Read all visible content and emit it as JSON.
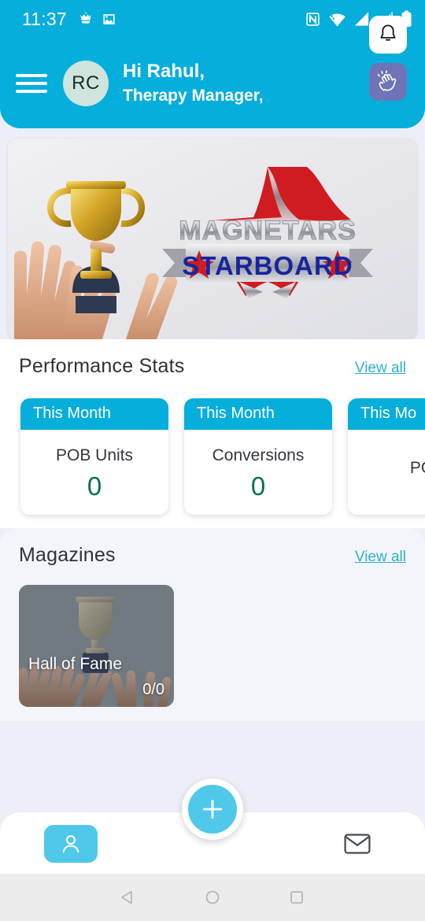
{
  "status_bar": {
    "time": "11:37",
    "left_icons": [
      "crown-notification-icon",
      "image-notification-icon"
    ],
    "right_icons": [
      "nfc-icon",
      "wifi-icon",
      "signal-sim1-icon",
      "signal-sim2-icon",
      "battery-icon"
    ]
  },
  "header": {
    "menu_icon": "hamburger-menu-icon",
    "avatar_initials": "RC",
    "greeting_line1": "Hi Rahul,",
    "greeting_line2": "Therapy Manager,",
    "bell_icon": "notification-bell-icon",
    "clap_icon": "clapping-hands-icon",
    "background_color": "#06aedb"
  },
  "banner": {
    "brand_text": "MAGNETARS",
    "ribbon_text": "STARBOARD",
    "alt": "trophy held by raised hands with Magnetars Starboard logo"
  },
  "performance": {
    "title": "Performance Stats",
    "view_all_label": "View all",
    "cards": [
      {
        "period": "This Month",
        "label": "POB Units",
        "value": "0"
      },
      {
        "period": "This Month",
        "label": "Conversions",
        "value": "0"
      },
      {
        "period": "This Mo",
        "label": "PO",
        "value": ""
      }
    ]
  },
  "magazines": {
    "title": "Magazines",
    "view_all_label": "View all",
    "items": [
      {
        "title": "Hall of Fame",
        "count": "0/0"
      }
    ]
  },
  "bottom_nav": {
    "items": [
      {
        "name": "profile",
        "icon": "person-icon",
        "active": true
      },
      {
        "name": "add",
        "icon": "plus-icon",
        "active": false
      },
      {
        "name": "mail",
        "icon": "envelope-icon",
        "active": false
      }
    ],
    "accent_color": "#4fc8ea"
  },
  "system_nav": {
    "back": "back-triangle-icon",
    "home": "home-circle-icon",
    "recents": "recents-square-icon"
  },
  "colors": {
    "primary": "#06aedb",
    "accent": "#4fc8ea",
    "link": "#2bb3c8",
    "value_green": "#06734a",
    "page_bg": "#eeeef8"
  }
}
